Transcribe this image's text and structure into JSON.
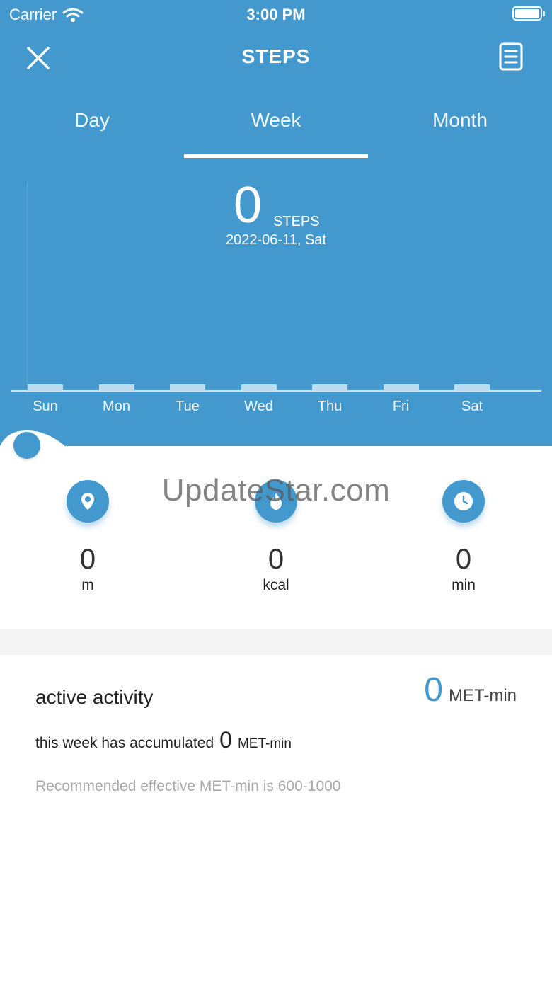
{
  "status_bar": {
    "carrier": "Carrier",
    "time": "3:00 PM"
  },
  "header": {
    "title": "STEPS"
  },
  "tabs": [
    {
      "label": "Day",
      "active": false
    },
    {
      "label": "Week",
      "active": true
    },
    {
      "label": "Month",
      "active": false
    }
  ],
  "summary": {
    "value": "0",
    "unit": "STEPS",
    "date": "2022-06-11, Sat"
  },
  "chart_data": {
    "type": "bar",
    "categories": [
      "Sun",
      "Mon",
      "Tue",
      "Wed",
      "Thu",
      "Fri",
      "Sat"
    ],
    "values": [
      0,
      0,
      0,
      0,
      0,
      0,
      0
    ]
  },
  "stats": [
    {
      "icon": "location-pin-icon",
      "value": "0",
      "unit": "m"
    },
    {
      "icon": "flame-icon",
      "value": "0",
      "unit": "kcal"
    },
    {
      "icon": "clock-icon",
      "value": "0",
      "unit": "min"
    }
  ],
  "watermark": "UpdateStar.com",
  "activity": {
    "title": "active activity",
    "total_value": "0",
    "total_unit": "MET-min",
    "week_prefix": "this week has accumulated",
    "week_value": "0",
    "week_unit": "MET-min",
    "recommendation": "Recommended effective MET-min is 600-1000"
  },
  "colors": {
    "primary": "#4399cd",
    "background": "#ffffff",
    "divider": "#f5f5f5"
  }
}
